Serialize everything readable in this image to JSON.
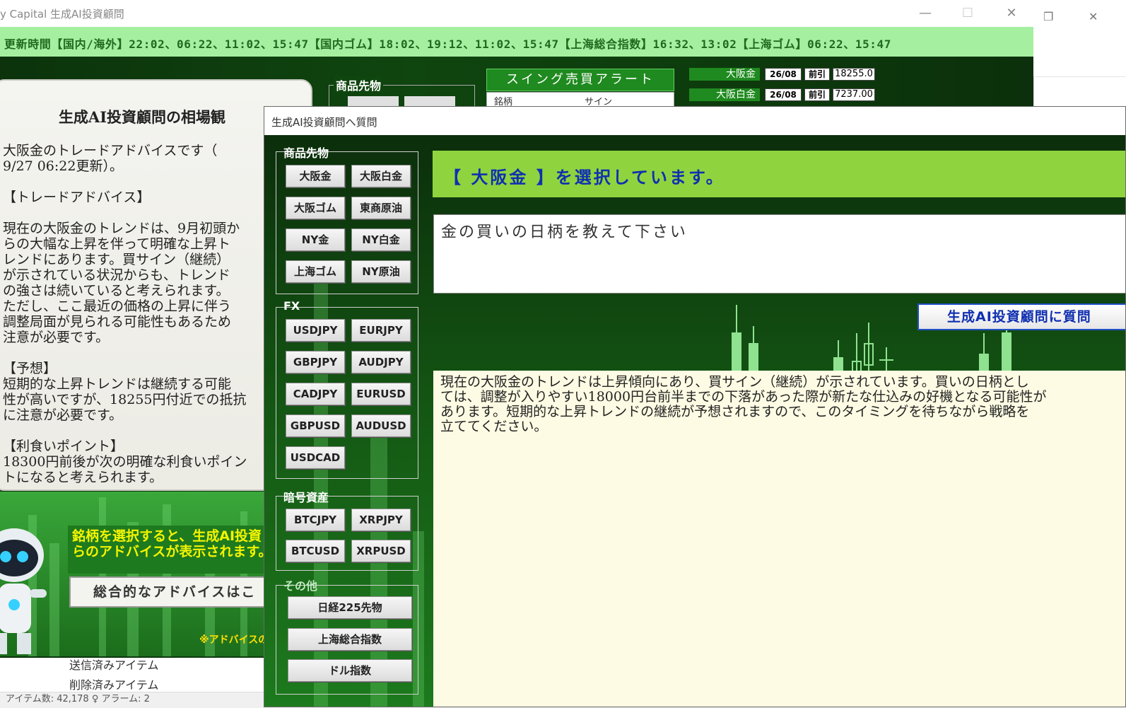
{
  "main_window": {
    "title": "y Capital 生成AI投資顧問",
    "update_bar": "更新時間【国内/海外】22:02、06:22、11:02、15:47【国内ゴム】18:02、19:12、11:02、15:47【上海総合指数】16:32、13:02【上海ゴム】06:22、15:47"
  },
  "market_view": {
    "title": "生成AI投資顧問の相場観",
    "body": "大阪金のトレードアドバイスです（\n9/27 06:22更新）。\n\n【トレードアドバイス】\n\n現在の大阪金のトレンドは、9月初頭か\nらの大幅な上昇を伴って明確な上昇ト\nレンドにあります。買サイン（継続）\nが示されている状況からも、トレンド\nの強さは続いていると考えられます。\nただし、ここ最近の価格の上昇に伴う\n調整局面が見られる可能性もあるため\n注意が必要です。\n\n【予想】\n短期的な上昇トレンドは継続する可能\n性が高いですが、18255円付近での抵抗\nに注意が必要です。\n\n【利食いポイント】\n18300円前後が次の明確な利食いポイン\nトになると考えられます。"
  },
  "promo": {
    "headline": "銘柄を選択すると、生成AI投資\nらのアドバイスが表示されます。",
    "button": "総合的なアドバイスはこ",
    "note": "※アドバイスの"
  },
  "top_widgets": {
    "commodity_label": "商品先物",
    "swing_alert": "スイング売買アラート",
    "swing_head_1": "銘柄",
    "swing_head_2": "サイン",
    "tickers": [
      {
        "name": "大阪金",
        "date": "26/08",
        "kind": "前引",
        "price": "18255.0"
      },
      {
        "name": "大阪白金",
        "date": "26/08",
        "kind": "前引",
        "price": "7237.00"
      }
    ]
  },
  "dialog": {
    "title": "生成AI投資顧問へ質問",
    "groups": {
      "commodity": {
        "label": "商品先物",
        "buttons": [
          "大阪金",
          "大阪白金",
          "大阪ゴム",
          "東商原油",
          "NY金",
          "NY白金",
          "上海ゴム",
          "NY原油"
        ]
      },
      "fx": {
        "label": "FX",
        "buttons": [
          "USDJPY",
          "EURJPY",
          "GBPJPY",
          "AUDJPY",
          "CADJPY",
          "EURUSD",
          "GBPUSD",
          "AUDUSD",
          "USDCAD"
        ]
      },
      "crypto": {
        "label": "暗号資産",
        "buttons": [
          "BTCJPY",
          "XRPJPY",
          "BTCUSD",
          "XRPUSD"
        ]
      },
      "other": {
        "label": "その他",
        "buttons": [
          "日経225先物",
          "上海総合指数",
          "ドル指数"
        ]
      }
    },
    "selection_text": "【 大阪金 】を選択しています。",
    "question": "金の買いの日柄を教えて下さい",
    "ask_button": "生成AI投資顧問に質問",
    "answer": "現在の大阪金のトレンドは上昇傾向にあり、買サイン（継続）が示されています。買いの日柄とし\nては、調整が入りやすい18000円台前半までの下落があった際が新たな仕込みの好機となる可能性が\nあります。短期的な上昇トレンドの継続が予想されますので、このタイミングを待ちながら戦略を\n立ててください。"
  },
  "background_app": {
    "nav_sent": "送信済みアイテム",
    "nav_deleted": "削除済みアイテム",
    "status": "アイテム数: 42,178    ♀ アラーム: 2"
  }
}
